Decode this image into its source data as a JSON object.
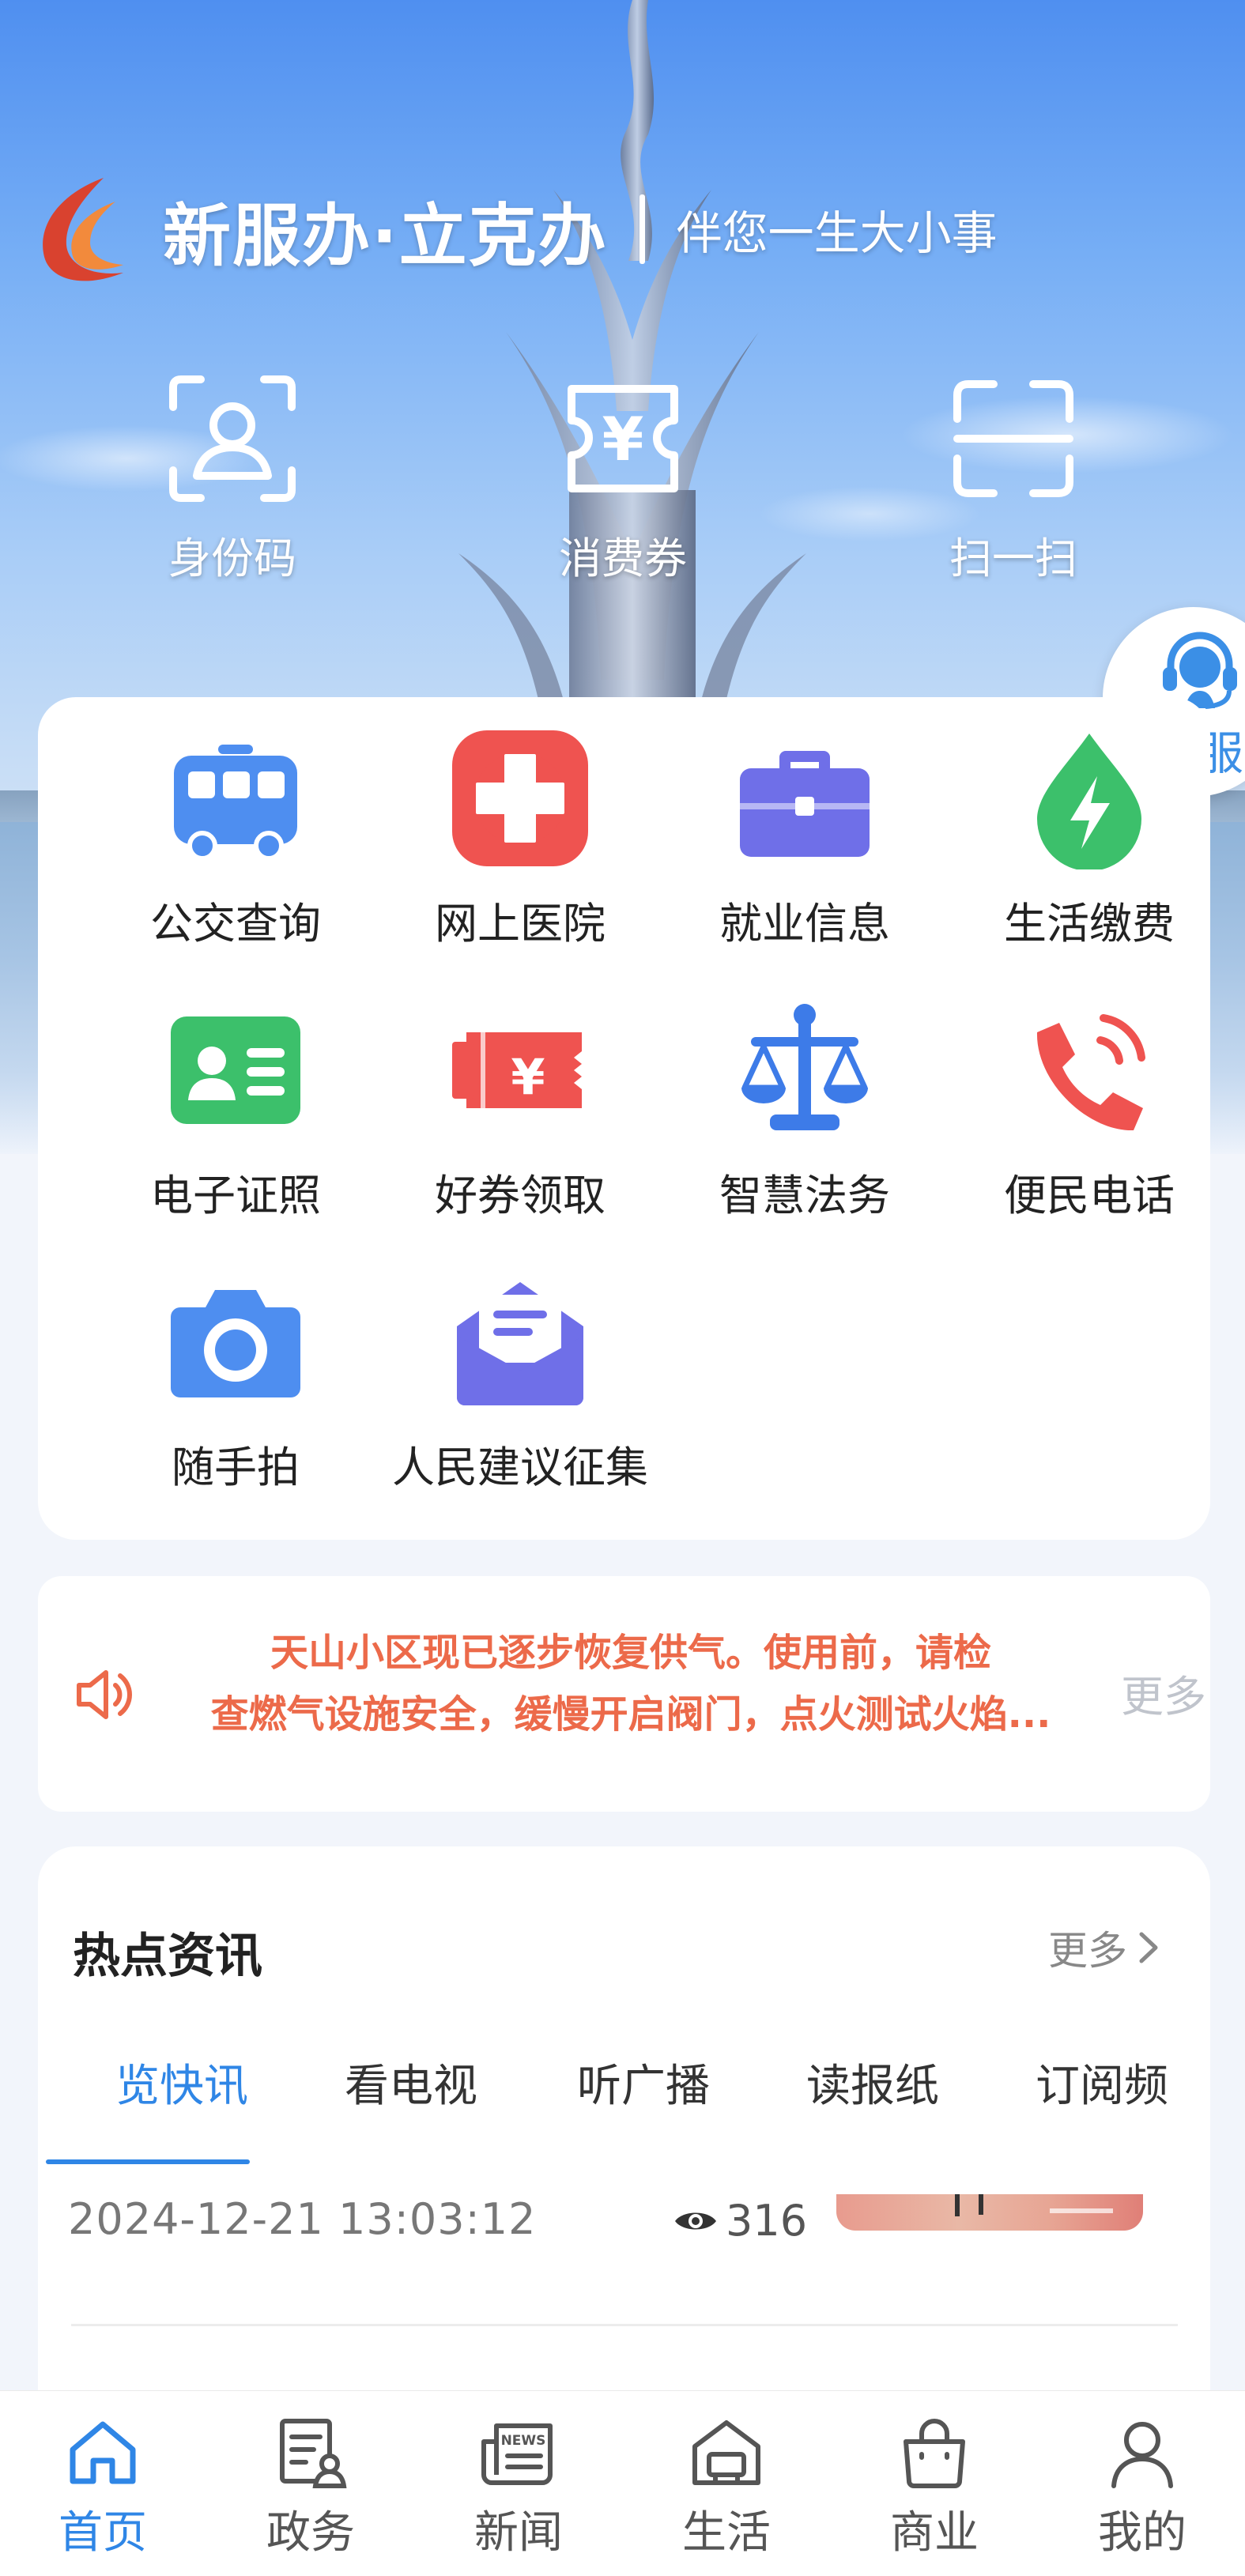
{
  "brand": {
    "title": "新服办·立克办",
    "slogan": "伴您一生大小事"
  },
  "quick_actions": [
    {
      "label": "身份码",
      "icon": "id-code-icon"
    },
    {
      "label": "消费券",
      "icon": "voucher-icon"
    },
    {
      "label": "扫一扫",
      "icon": "scan-icon"
    }
  ],
  "customer_service": {
    "label": "客服",
    "icon": "headset-icon"
  },
  "services": [
    {
      "label": "公交查询",
      "icon": "bus-icon",
      "color": "#4e8ef0"
    },
    {
      "label": "网上医院",
      "icon": "medical-cross-icon",
      "color": "#ef5350"
    },
    {
      "label": "就业信息",
      "icon": "briefcase-icon",
      "color": "#6f6fe8"
    },
    {
      "label": "生活缴费",
      "icon": "lightning-drop-icon",
      "color": "#3cc06b"
    },
    {
      "label": "电子证照",
      "icon": "id-card-icon",
      "color": "#3cc06b"
    },
    {
      "label": "好券领取",
      "icon": "coupon-icon",
      "color": "#ef5350"
    },
    {
      "label": "智慧法务",
      "icon": "scales-icon",
      "color": "#3d7be8"
    },
    {
      "label": "便民电话",
      "icon": "phone-icon",
      "color": "#ef5350"
    },
    {
      "label": "随手拍",
      "icon": "camera-icon",
      "color": "#4e8ef0"
    },
    {
      "label": "人民建议征集",
      "icon": "envelope-icon",
      "color": "#6f6fe8"
    }
  ],
  "notice": {
    "icon": "speaker-icon",
    "line1": "天山小区现已逐步恢复供气。使用前，请检",
    "line2": "查燃气设施安全，缓慢开启阀门，点火测试火焰...",
    "more": "更多"
  },
  "news": {
    "title": "热点资讯",
    "more": "更多",
    "tabs": [
      "览快讯",
      "看电视",
      "听广播",
      "读报纸",
      "订阅频"
    ],
    "active_tab": 0,
    "item": {
      "date": "2024-12-21 13:03:12",
      "views": "316"
    }
  },
  "nav": [
    {
      "label": "首页",
      "icon": "home-icon",
      "active": true
    },
    {
      "label": "政务",
      "icon": "government-icon",
      "active": false
    },
    {
      "label": "新闻",
      "icon": "newspaper-icon",
      "active": false
    },
    {
      "label": "生活",
      "icon": "life-icon",
      "active": false
    },
    {
      "label": "商业",
      "icon": "shopping-bag-icon",
      "active": false
    },
    {
      "label": "我的",
      "icon": "profile-icon",
      "active": false
    }
  ],
  "colors": {
    "accent": "#2f86e6",
    "notice_text": "#ec6a4a"
  }
}
